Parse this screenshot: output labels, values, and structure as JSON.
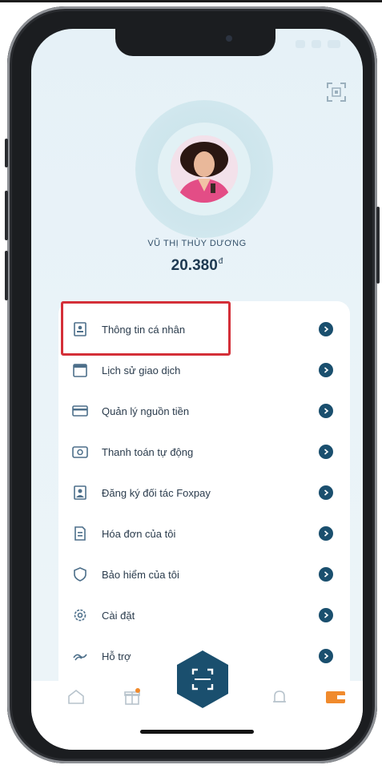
{
  "profile": {
    "name": "VŨ THỊ THÙY DƯƠNG",
    "balance": "20.380",
    "currency": "đ"
  },
  "menu": {
    "items": [
      {
        "label": "Thông tin cá nhân",
        "icon": "id-card-icon"
      },
      {
        "label": "Lịch sử giao dịch",
        "icon": "calendar-icon"
      },
      {
        "label": "Quản lý nguồn tiền",
        "icon": "wallet-card-icon"
      },
      {
        "label": "Thanh toán tự động",
        "icon": "auto-pay-icon"
      },
      {
        "label": "Đăng ký đối tác Foxpay",
        "icon": "partner-icon"
      },
      {
        "label": "Hóa đơn của tôi",
        "icon": "invoice-icon"
      },
      {
        "label": "Bảo hiểm của tôi",
        "icon": "shield-icon"
      },
      {
        "label": "Cài đặt",
        "icon": "gear-icon"
      },
      {
        "label": "Hỗ trợ",
        "icon": "support-icon"
      }
    ]
  },
  "bottom_nav": {
    "items": [
      "home-icon",
      "gift-icon",
      "scan-icon",
      "notification-icon",
      "wallet-icon"
    ],
    "active": "wallet-icon"
  },
  "colors": {
    "accent": "#1a4f6e",
    "highlight": "#d42f38",
    "wallet_active": "#f08a2c",
    "background": "#e9f3f8"
  }
}
